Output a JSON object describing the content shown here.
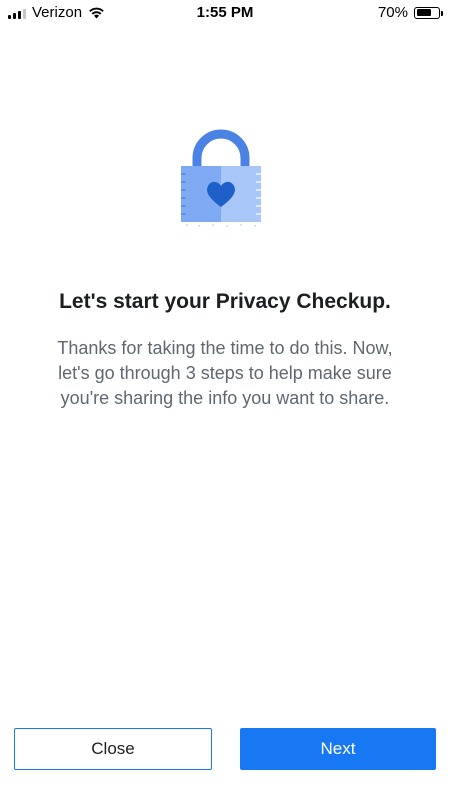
{
  "status_bar": {
    "carrier": "Verizon",
    "time": "1:55 PM",
    "battery_text": "70%",
    "battery_level": 0.7
  },
  "illustration": {
    "icon": "lock-heart-icon",
    "colors": {
      "shackle": "#4a83e3",
      "body_left": "#7fa9f2",
      "body_right": "#a9c6f9",
      "heart": "#1e5fc9"
    }
  },
  "content": {
    "title": "Let's start your Privacy Checkup.",
    "body_lines": [
      "Thanks for taking the time to do this. Now,",
      "let's go through 3 steps to help make sure",
      "you're sharing the info you want to share."
    ]
  },
  "actions": {
    "close_label": "Close",
    "next_label": "Next",
    "accent": "#1877f2"
  }
}
